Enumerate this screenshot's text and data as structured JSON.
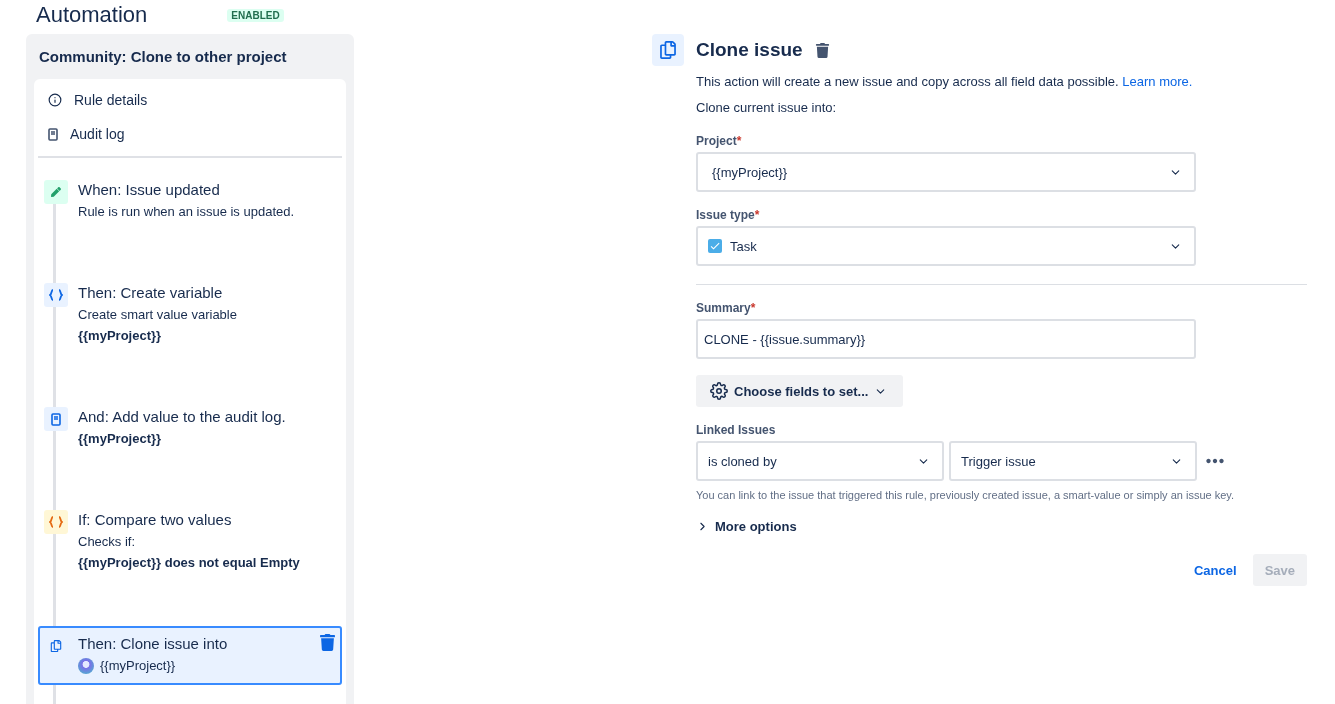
{
  "header": {
    "title": "Automation",
    "status": "ENABLED"
  },
  "rule": {
    "name": "Community: Clone to other project",
    "nav": [
      {
        "kind": "info",
        "label": "Rule details"
      },
      {
        "kind": "log",
        "label": "Audit log"
      }
    ],
    "steps": [
      {
        "kind": "trigger",
        "title": "When: Issue updated",
        "lines": [
          "Rule is run when an issue is updated."
        ],
        "selected": false
      },
      {
        "kind": "variable",
        "title": "Then: Create variable",
        "lines": [
          "Create smart value variable",
          "**{{myProject}}**"
        ],
        "selected": false
      },
      {
        "kind": "log",
        "title": "And: Add value to the audit log.",
        "lines": [
          "**{{myProject}}**"
        ],
        "selected": false
      },
      {
        "kind": "condition",
        "title": "If: Compare two values",
        "lines": [
          "Checks if:",
          "**{{myProject}} does not equal Empty**"
        ],
        "selected": false
      },
      {
        "kind": "clone",
        "title": "Then: Clone issue into",
        "project": "{{myProject}}",
        "selected": true
      }
    ]
  },
  "action": {
    "title": "Clone issue",
    "description": "This action will create a new issue and copy across all field data possible.",
    "learn_more": "Learn more.",
    "intro": "Clone current issue into:",
    "project": {
      "label": "Project",
      "required_mark": "*",
      "value": "{{myProject}}"
    },
    "issue_type": {
      "label": "Issue type",
      "required_mark": "*",
      "value": "Task",
      "checked": true
    },
    "summary": {
      "label": "Summary",
      "required_mark": "*",
      "value": "CLONE - {{issue.summary}}"
    },
    "choose_fields": "Choose fields to set...",
    "linked": {
      "label": "Linked Issues",
      "type": "is cloned by",
      "target": "Trigger issue",
      "hint": "You can link to the issue that triggered this rule, previously created issue, a smart-value or simply an issue key."
    },
    "more_options": "More options",
    "expanded": false,
    "cancel": "Cancel",
    "save": "Save",
    "save_disabled": true
  }
}
